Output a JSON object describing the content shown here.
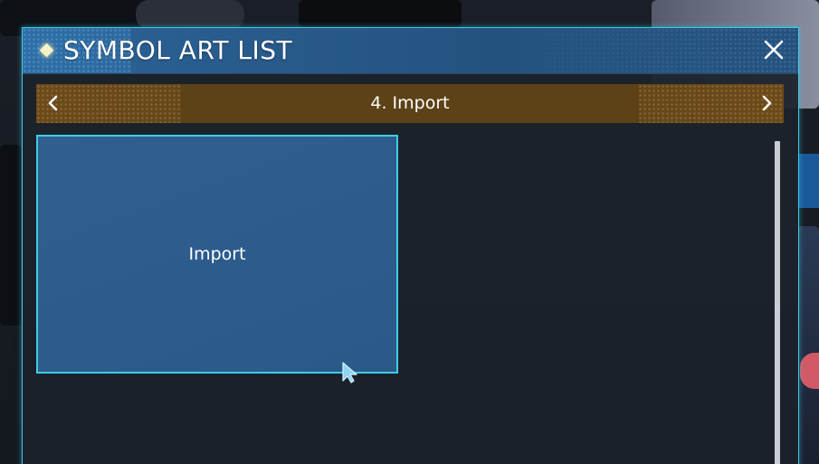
{
  "window": {
    "title": "SYMBOL ART LIST",
    "close_icon": "close-icon",
    "title_icon": "diamond-icon"
  },
  "category": {
    "label": "4. Import",
    "prev_icon": "chevron-left-icon",
    "next_icon": "chevron-right-icon"
  },
  "tiles": [
    {
      "label": "Import"
    }
  ],
  "colors": {
    "accent_cyan": "#41cbe8",
    "title_blue": "#2a5f92",
    "category_gold": "#5c4216",
    "tile_blue": "#2c5c8b"
  }
}
